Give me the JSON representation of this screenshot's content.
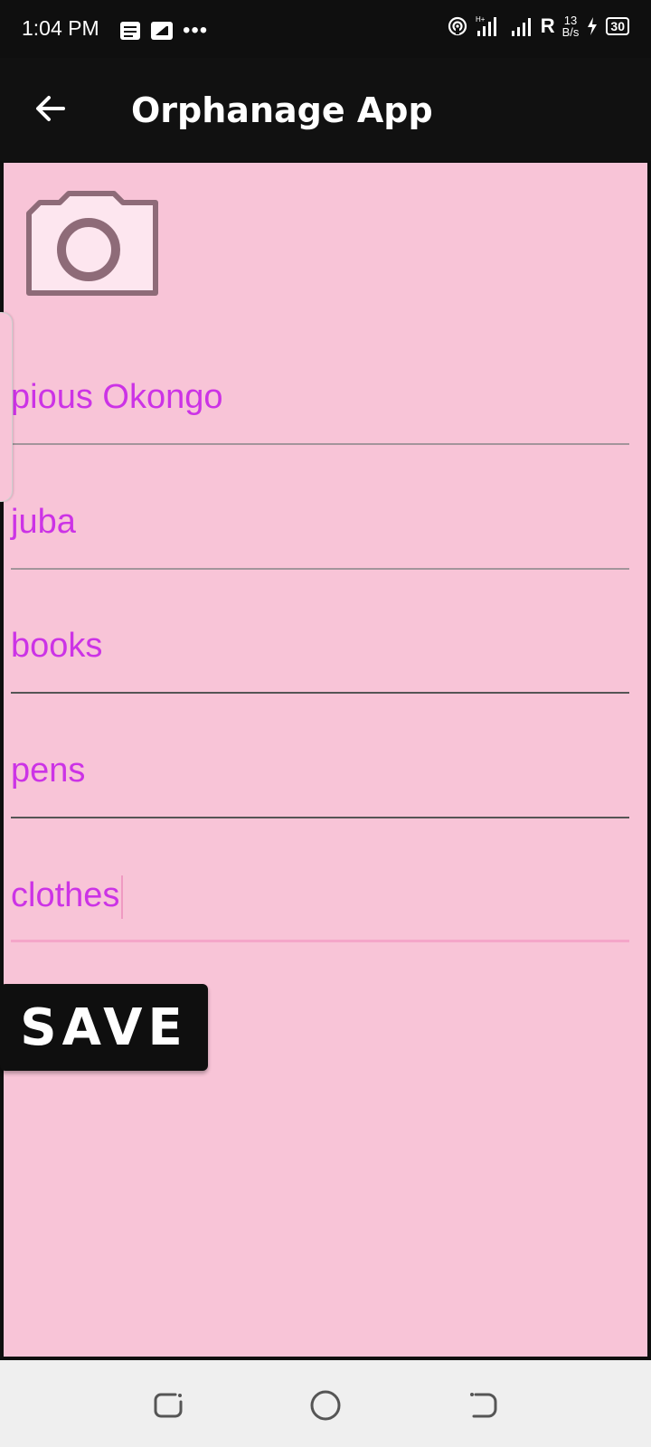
{
  "status_bar": {
    "time": "1:04 PM",
    "dots": "•••",
    "network": "R",
    "speed_value": "13",
    "speed_unit": "B/s",
    "battery": "30"
  },
  "app_bar": {
    "title": "Orphanage App"
  },
  "form": {
    "fields": [
      {
        "value": "pious Okongo"
      },
      {
        "value": "juba"
      },
      {
        "value": "books"
      },
      {
        "value": "pens"
      },
      {
        "value": "clothes"
      }
    ],
    "save_label": "SAVE"
  },
  "colors": {
    "background": "#f8c4d7",
    "text_accent": "#cc33e6",
    "bar": "#111111"
  },
  "icons": {
    "back": "arrow-left-icon",
    "camera": "camera-icon",
    "nav_recents": "recents-icon",
    "nav_home": "home-icon",
    "nav_back": "back-icon"
  }
}
